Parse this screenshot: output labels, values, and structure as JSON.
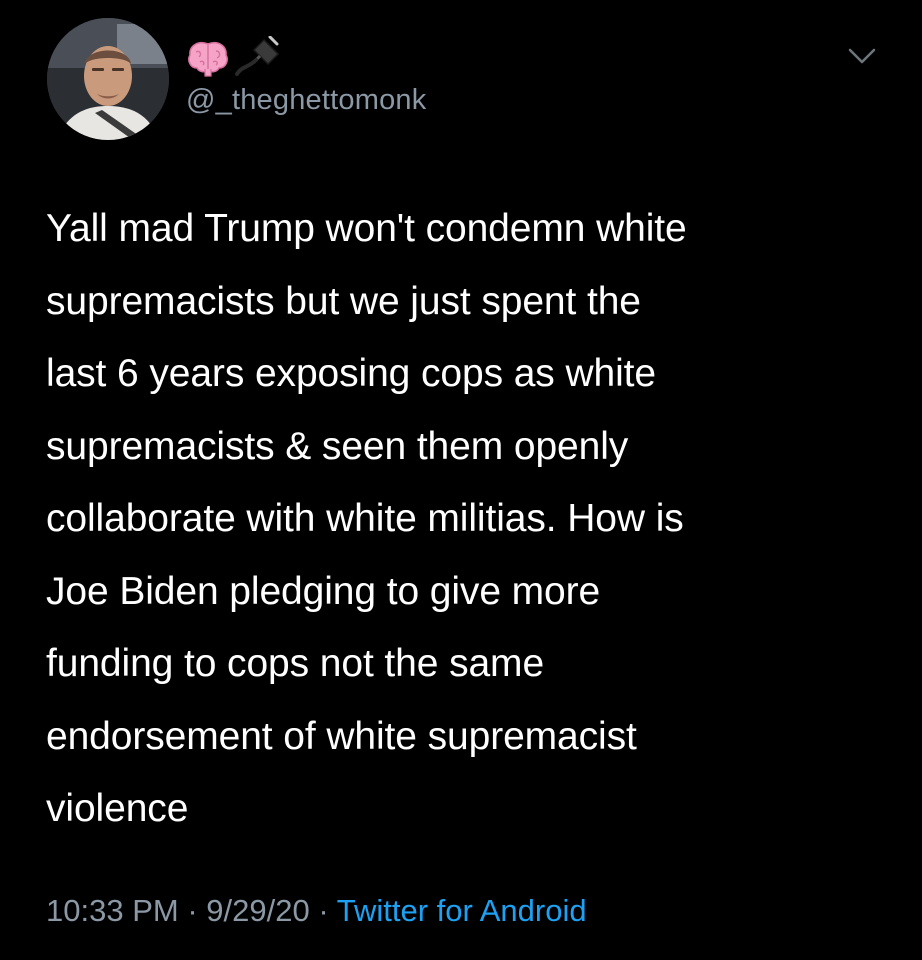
{
  "tweet": {
    "handle": "@_theghettomonk",
    "name_emojis": [
      "brain-icon",
      "electric-plug-icon"
    ],
    "text": "Yall mad Trump won't condemn white\nsupremacists but we just spent the\nlast 6 years exposing cops as white\nsupremacists & seen them openly\ncollaborate with white militias. How is\nJoe Biden pledging to give more\nfunding to cops not the same\nendorsement of white supremacist\nviolence",
    "time": "10:33 PM",
    "separator": "·",
    "date": "9/29/20",
    "source": "Twitter for Android"
  },
  "colors": {
    "background": "#000000",
    "text": "#ffffff",
    "secondary_text": "#8b98a5",
    "link": "#1da1f2"
  }
}
